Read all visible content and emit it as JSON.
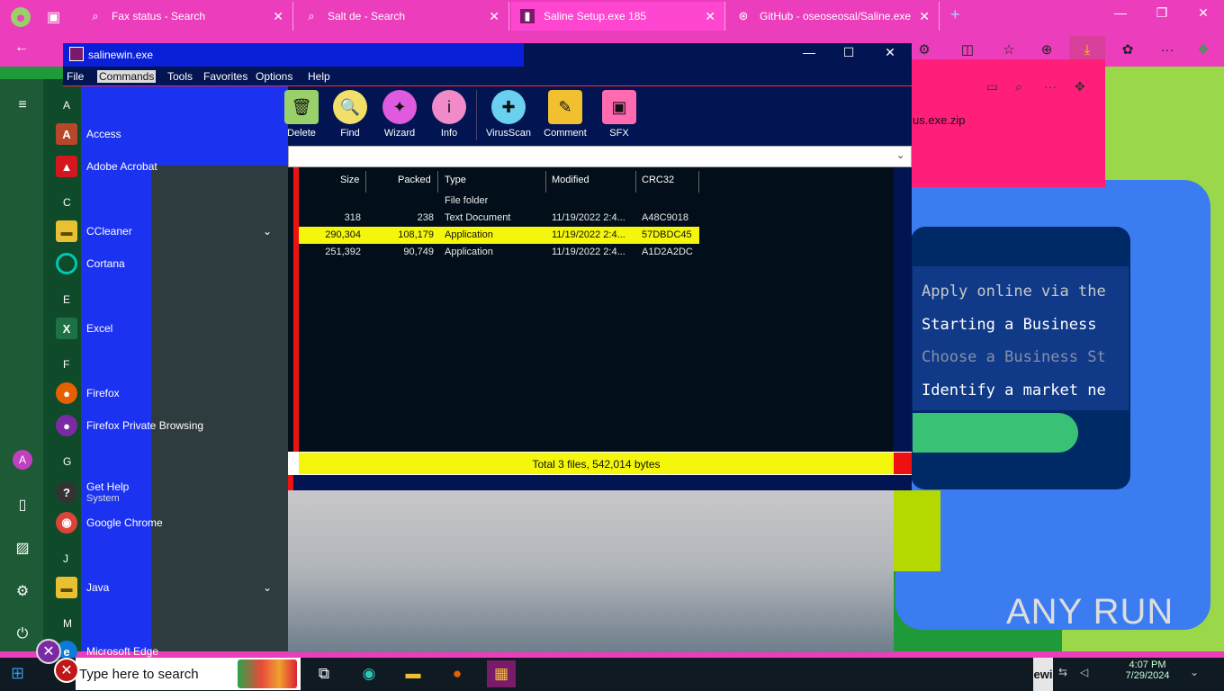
{
  "browser": {
    "tabs": [
      {
        "label": "Fax status - Search",
        "icon": "search-icon"
      },
      {
        "label": "Salt de - Search",
        "icon": "search-icon"
      },
      {
        "label": "Saline Setup.exe 185",
        "icon": "anyrun-icon",
        "active": true
      },
      {
        "label": "GitHub - oseoseosal/Saline.exe",
        "icon": "github-icon"
      }
    ],
    "new_tab": "+",
    "page": {
      "filename_fragment": "us.exe.zip",
      "list_lines": [
        {
          "text": "Apply online via the",
          "color": "#c8c8c8"
        },
        {
          "text": "Starting a Business ",
          "color": "#ffffff"
        },
        {
          "text": "Choose a Business St",
          "color": "#888ea8"
        },
        {
          "text": "Identify a market ne",
          "color": "#ffffff"
        }
      ],
      "watermark": "ANY RUN"
    }
  },
  "start_menu": {
    "sections": [
      {
        "letter": "A",
        "apps": [
          {
            "name": "Access",
            "icon_bg": "#b7472a",
            "glyph": "A"
          },
          {
            "name": "Adobe Acrobat",
            "icon_bg": "#d4161e",
            "glyph": "▲"
          }
        ]
      },
      {
        "letter": "C",
        "apps": [
          {
            "name": "CCleaner",
            "icon_bg": "#e8c031",
            "glyph": "▬",
            "expandable": true
          },
          {
            "name": "Cortana",
            "icon_bg": "#00a8a8",
            "glyph": "○"
          }
        ]
      },
      {
        "letter": "E",
        "apps": [
          {
            "name": "Excel",
            "icon_bg": "#1e7145",
            "glyph": "X"
          }
        ]
      },
      {
        "letter": "F",
        "apps": [
          {
            "name": "Firefox",
            "icon_bg": "#e66000",
            "glyph": "●"
          },
          {
            "name": "Firefox Private Browsing",
            "icon_bg": "#7b2aa4",
            "glyph": "●"
          }
        ]
      },
      {
        "letter": "G",
        "apps": [
          {
            "name": "Get Help",
            "sub": "System",
            "icon_bg": "#333333",
            "glyph": "?"
          },
          {
            "name": "Google Chrome",
            "icon_bg": "#db4437",
            "glyph": "◉"
          }
        ]
      },
      {
        "letter": "J",
        "apps": [
          {
            "name": "Java",
            "icon_bg": "#e8c031",
            "glyph": "▬",
            "expandable": true
          }
        ]
      },
      {
        "letter": "M",
        "apps": [
          {
            "name": "Microsoft Edge",
            "icon_bg": "#0c7ad6",
            "glyph": "e"
          }
        ]
      }
    ]
  },
  "winrar": {
    "title": "salinewin.exe",
    "menu": [
      "File",
      "Commands",
      "Tools",
      "Favorites",
      "Options",
      "Help"
    ],
    "toolbar": [
      {
        "label": "Delete",
        "icon": "trash-icon",
        "color": "#9ad06a",
        "glyph": "🗑"
      },
      {
        "label": "Find",
        "icon": "find-icon",
        "color": "#f0e06a",
        "glyph": "🔍"
      },
      {
        "label": "Wizard",
        "icon": "wizard-icon",
        "color": "#e05ae0",
        "glyph": "✦"
      },
      {
        "label": "Info",
        "icon": "info-icon",
        "color": "#f08ac8",
        "glyph": "i"
      },
      {
        "label": "VirusScan",
        "icon": "virusscan-icon",
        "color": "#6ad0f0",
        "glyph": "✚"
      },
      {
        "label": "Comment",
        "icon": "comment-icon",
        "color": "#f0c030",
        "glyph": "✎"
      },
      {
        "label": "SFX",
        "icon": "sfx-icon",
        "color": "#ff6ab0",
        "glyph": "▣"
      }
    ],
    "columns": [
      "Size",
      "Packed",
      "Type",
      "Modified",
      "CRC32"
    ],
    "rows": [
      {
        "size": "",
        "packed": "",
        "type": "File folder",
        "modified": "",
        "crc": "",
        "selected": false
      },
      {
        "size": "318",
        "packed": "238",
        "type": "Text Document",
        "modified": "11/19/2022 2:4...",
        "crc": "A48C9018",
        "selected": false
      },
      {
        "size": "290,304",
        "packed": "108,179",
        "type": "Application",
        "modified": "11/19/2022 2:4...",
        "crc": "57DBDC45",
        "selected": true
      },
      {
        "size": "251,392",
        "packed": "90,749",
        "type": "Application",
        "modified": "11/19/2022 2:4...",
        "crc": "A1D2A2DC",
        "selected": false
      }
    ],
    "status": "Total 3 files, 542,014 bytes"
  },
  "taskbar": {
    "search_placeholder": "Type here to search",
    "winrar_label": "ewi",
    "time": "4:07 PM",
    "date": "7/29/2024"
  }
}
